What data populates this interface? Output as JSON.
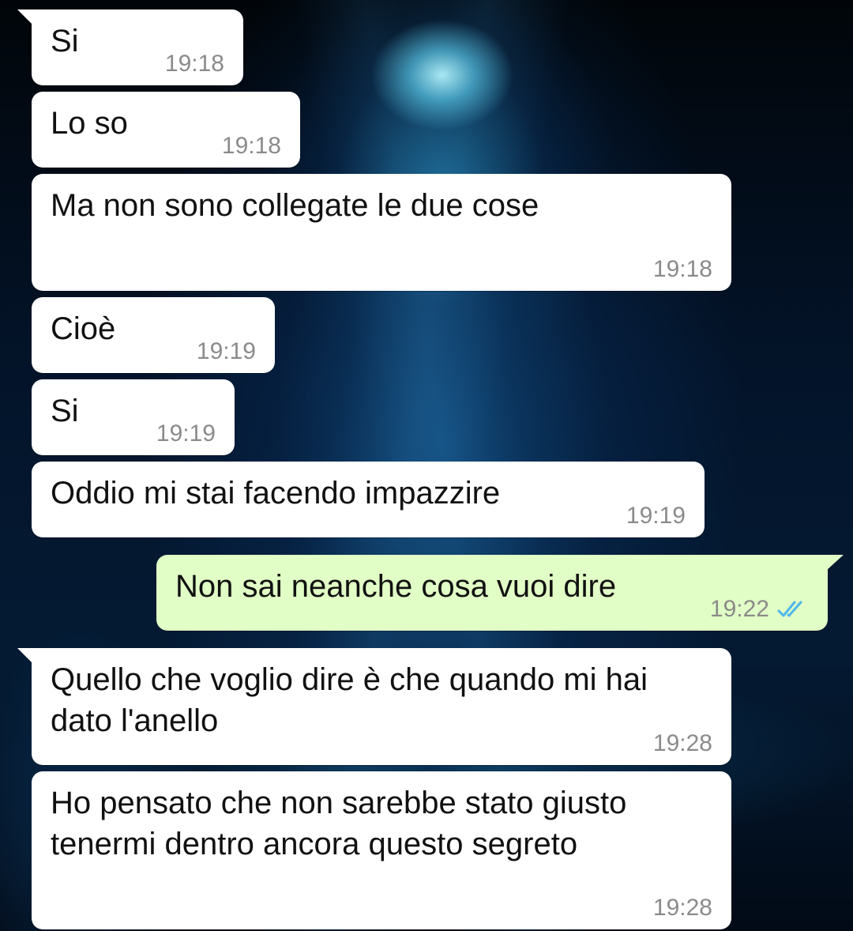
{
  "messages": [
    {
      "text": "Si",
      "time": "19:18"
    },
    {
      "text": "Lo so",
      "time": "19:18"
    },
    {
      "text": "Ma non sono collegate le due cose",
      "time": "19:18"
    },
    {
      "text": "Cioè",
      "time": "19:19"
    },
    {
      "text": "Si",
      "time": "19:19"
    },
    {
      "text": "Oddio mi stai facendo impazzire",
      "time": "19:19"
    },
    {
      "text": "Non sai neanche cosa vuoi dire",
      "time": "19:22",
      "status_icon": "double-check-icon",
      "status_color": "#4fb6ec"
    },
    {
      "text": "Quello che voglio dire è che quando mi hai\ndato l'anello",
      "time": "19:28"
    },
    {
      "text": "Ho pensato che non sarebbe stato giusto\ntenermi dentro ancora questo segreto",
      "time": "19:28"
    }
  ],
  "colors": {
    "incoming_bubble": "#ffffff",
    "outgoing_bubble": "#e1fec6",
    "timestamp": "#8b8b8b",
    "read_receipt": "#4fb6ec"
  }
}
